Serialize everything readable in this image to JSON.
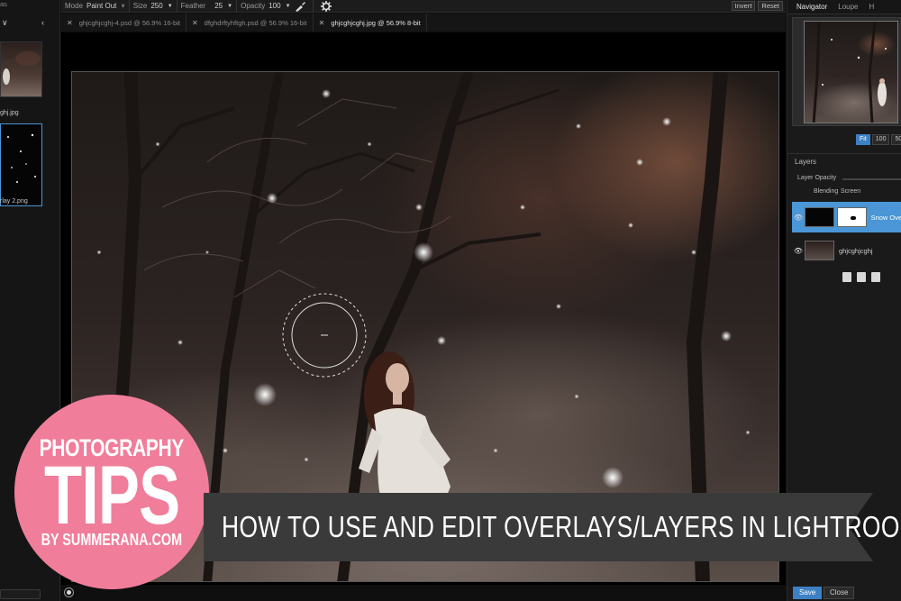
{
  "toolbar": {
    "mode_label": "Mode",
    "mode_value": "Paint Out",
    "size_label": "Size",
    "size_value": "250",
    "feather_label": "Feather",
    "feather_value": "25",
    "opacity_label": "Opacity",
    "opacity_value": "100",
    "invert_label": "Invert",
    "reset_label": "Reset"
  },
  "tabs": [
    {
      "label": "ghjcghjcghj-4.psd @ 56.9% 16-bit",
      "active": false
    },
    {
      "label": "dfghdrftyhftgh.psd @ 56.9% 16-bit",
      "active": false
    },
    {
      "label": "ghjcghjcghj.jpg @ 56.9% 8-bit",
      "active": true
    }
  ],
  "left_panel": {
    "header": "as",
    "thumbs": [
      {
        "name": "ghj.jpg"
      },
      {
        "name": "rlay 2.png"
      }
    ]
  },
  "right_panel": {
    "tabs": [
      "Navigator",
      "Loupe",
      "H"
    ],
    "zoom_buttons": [
      "Fit",
      "100",
      "50",
      ""
    ],
    "layers_title": "Layers",
    "layer_opacity_label": "Layer Opacity",
    "blending_label": "Blending",
    "blending_value": "Screen",
    "layers": [
      {
        "name": "Snow Ove",
        "selected": true
      },
      {
        "name": "ghjcghjcghj",
        "selected": false
      }
    ],
    "save_label": "Save",
    "close_label": "Close"
  },
  "overlay": {
    "badge_top": "PHOTOGRAPHY",
    "badge_big": "TIPS",
    "badge_by": "BY SUMMERANA.COM",
    "banner": "HOW TO USE AND EDIT OVERLAYS/LAYERS IN LIGHTROOM"
  },
  "colors": {
    "accent": "#4a96d6",
    "badge": "#f07d9a",
    "banner": "#3a3a3a"
  }
}
